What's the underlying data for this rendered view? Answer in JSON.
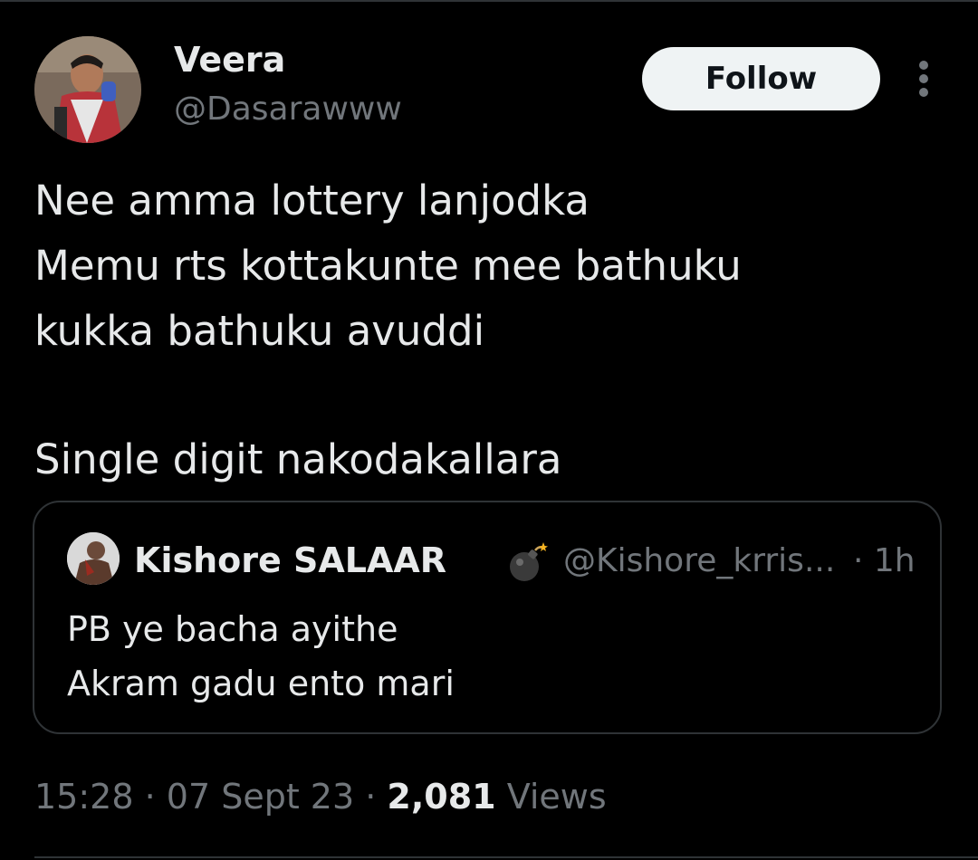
{
  "author": {
    "name": "Veera",
    "handle": "@Dasarawww"
  },
  "follow_label": "Follow",
  "more_icon": "more-vertical-icon",
  "tweet": {
    "lines": [
      "Nee amma lottery lanjodka",
      "Memu rts kottakunte mee bathuku",
      "kukka bathuku avuddi",
      "Single digit nakodakallara"
    ]
  },
  "quoted_tweet": {
    "name": "Kishore SALAAR",
    "name_emoji": "bomb-icon",
    "handle": "@Kishore_krris...",
    "time": "· 1h",
    "lines": [
      "PB ye bacha ayithe",
      "Akram gadu ento mari"
    ]
  },
  "meta": {
    "time": "15:28",
    "sep1": " · ",
    "date": "07 Sept 23",
    "sep2": " · ",
    "views_count": "2,081",
    "views_label": " Views"
  },
  "colors": {
    "background": "#000000",
    "text_primary": "#e7e9ea",
    "text_secondary": "#71767b",
    "border": "#2f3336",
    "follow_button_bg": "#eff3f4"
  }
}
